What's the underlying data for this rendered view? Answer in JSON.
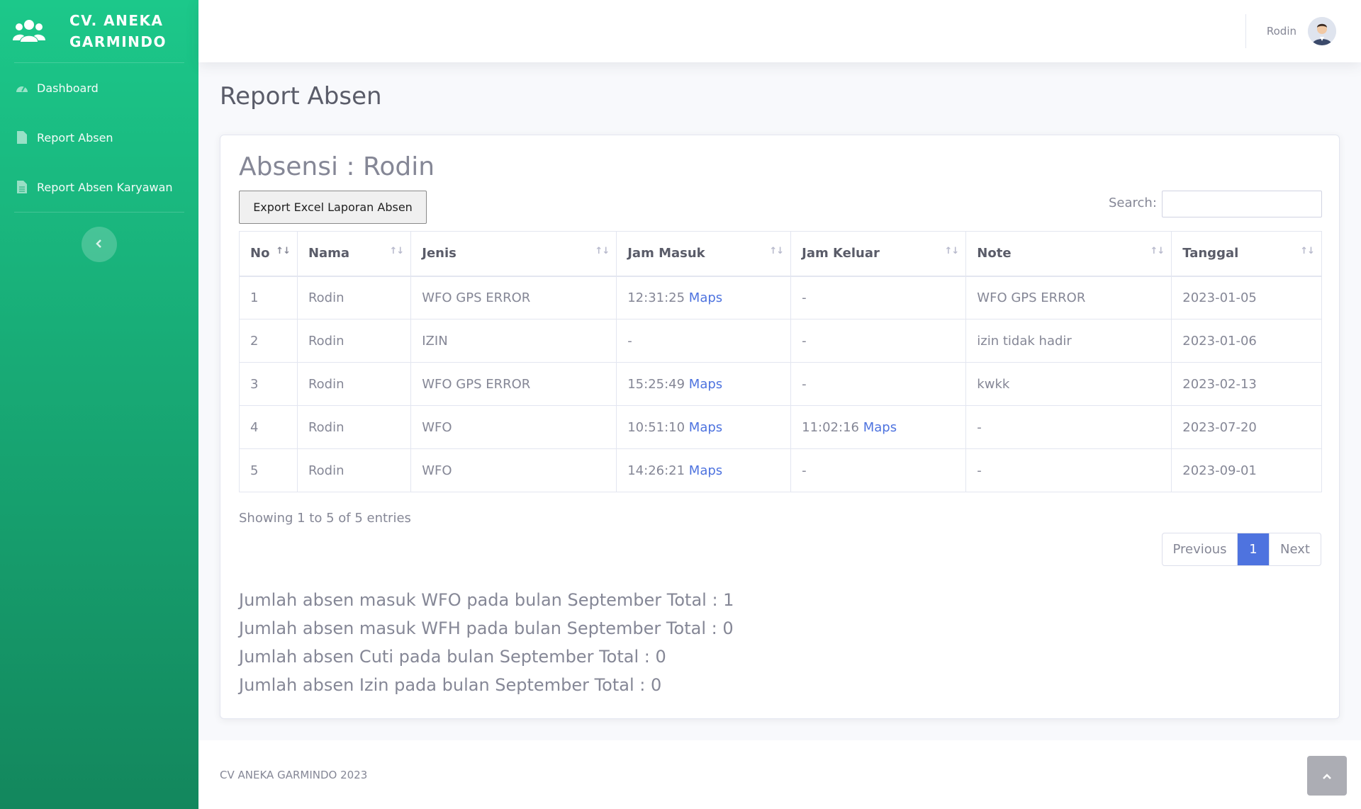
{
  "brand": {
    "name": "CV. ANEKA GARMINDO",
    "icon": "users-icon"
  },
  "sidebar": {
    "items": [
      {
        "label": "Dashboard",
        "icon": "tachometer-icon"
      },
      {
        "label": "Report Absen",
        "icon": "file-icon"
      },
      {
        "label": "Report Absen Karyawan",
        "icon": "file-alt-icon"
      }
    ],
    "toggle_icon": "chevron-left-icon"
  },
  "topbar": {
    "user_name": "Rodin",
    "avatar": "user-avatar"
  },
  "page": {
    "title": "Report Absen"
  },
  "card": {
    "title": "Absensi : Rodin",
    "export_label": "Export Excel Laporan Absen",
    "search_label": "Search:",
    "search_value": ""
  },
  "table": {
    "columns": [
      "No",
      "Nama",
      "Jenis",
      "Jam Masuk",
      "Jam Keluar",
      "Note",
      "Tanggal"
    ],
    "rows": [
      {
        "no": "1",
        "nama": "Rodin",
        "jenis": "WFO GPS ERROR",
        "jam_masuk": "12:31:25",
        "jam_masuk_link": "Maps",
        "jam_keluar": "-",
        "jam_keluar_link": "",
        "note": "WFO GPS ERROR",
        "tanggal": "2023-01-05"
      },
      {
        "no": "2",
        "nama": "Rodin",
        "jenis": "IZIN",
        "jam_masuk": "-",
        "jam_masuk_link": "",
        "jam_keluar": "-",
        "jam_keluar_link": "",
        "note": "izin tidak hadir",
        "tanggal": "2023-01-06"
      },
      {
        "no": "3",
        "nama": "Rodin",
        "jenis": "WFO GPS ERROR",
        "jam_masuk": "15:25:49",
        "jam_masuk_link": "Maps",
        "jam_keluar": "-",
        "jam_keluar_link": "",
        "note": "kwkk",
        "tanggal": "2023-02-13"
      },
      {
        "no": "4",
        "nama": "Rodin",
        "jenis": "WFO",
        "jam_masuk": "10:51:10",
        "jam_masuk_link": "Maps",
        "jam_keluar": "11:02:16",
        "jam_keluar_link": "Maps",
        "note": "-",
        "tanggal": "2023-07-20"
      },
      {
        "no": "5",
        "nama": "Rodin",
        "jenis": "WFO",
        "jam_masuk": "14:26:21",
        "jam_masuk_link": "Maps",
        "jam_keluar": "-",
        "jam_keluar_link": "",
        "note": "-",
        "tanggal": "2023-09-01"
      }
    ]
  },
  "info": "Showing 1 to 5 of 5 entries",
  "pagination": {
    "previous": "Previous",
    "current": "1",
    "next": "Next"
  },
  "summary": [
    "Jumlah absen masuk WFO pada bulan September Total : 1",
    "Jumlah absen masuk WFH pada bulan September Total : 0",
    "Jumlah absen Cuti pada bulan September Total : 0",
    "Jumlah absen Izin pada bulan September Total : 0"
  ],
  "footer": {
    "text": "CV ANEKA GARMINDO 2023",
    "scroll_icon": "chevron-up-icon"
  },
  "colors": {
    "sidebar_top": "#1cc88a",
    "sidebar_bottom": "#13875d",
    "primary": "#4e73df",
    "text": "#858796"
  }
}
